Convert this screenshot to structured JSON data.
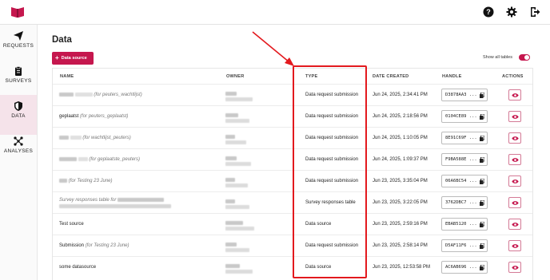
{
  "topbar": {
    "help_icon": "help-icon",
    "settings_icon": "gear-icon",
    "logout_icon": "logout-icon"
  },
  "sidebar": {
    "items": [
      {
        "label": "REQUESTS",
        "icon": "paper-plane-icon"
      },
      {
        "label": "SURVEYS",
        "icon": "clipboard-icon"
      },
      {
        "label": "DATA",
        "icon": "shield-icon",
        "active": true
      },
      {
        "label": "ANALYSES",
        "icon": "nodes-icon"
      }
    ]
  },
  "page": {
    "title": "Data",
    "add_button": "Data source",
    "show_all_label": "Show all tables"
  },
  "table": {
    "columns": [
      "NAME",
      "OWNER",
      "TYPE",
      "DATE CREATED",
      "HANDLE",
      "ACTIONS"
    ],
    "rows": [
      {
        "name": "",
        "for": "(for",
        "target": "peuters_wachtlijst)",
        "type": "Data request submission",
        "date": "Jun 24, 2025, 2:34:41 PM",
        "handle": "D3878AA3 ..."
      },
      {
        "name": "geplaatst",
        "for": "(for",
        "target": "peuters_geplaatst)",
        "type": "Data request submission",
        "date": "Jun 24, 2025, 2:18:56 PM",
        "handle": "0104CE89 ..."
      },
      {
        "name": "",
        "for": "(for",
        "target": "wachtlijst_peuters)",
        "type": "Data request submission",
        "date": "Jun 24, 2025, 1:10:05 PM",
        "handle": "8E91C69F ..."
      },
      {
        "name": "",
        "for": "(for",
        "target": "geplaatste_peuters)",
        "type": "Data request submission",
        "date": "Jun 24, 2025, 1:09:37 PM",
        "handle": "F9BA588E ..."
      },
      {
        "name": "",
        "for": "(for",
        "target": "Testing 23 June)",
        "type": "Data request submission",
        "date": "Jun 23, 2025, 3:35:04 PM",
        "handle": "06A6BC54 ..."
      },
      {
        "name": "Survey responses table for",
        "for": "",
        "target": "",
        "type": "Survey responses table",
        "date": "Jun 23, 2025, 3:22:05 PM",
        "handle": "3762DBC7 ..."
      },
      {
        "name": "Test source",
        "for": "",
        "target": "",
        "type": "Data source",
        "date": "Jun 23, 2025, 2:59:16 PM",
        "handle": "EBAB5120 ..."
      },
      {
        "name": "Submission",
        "for": "(for",
        "target": "Testing 23 June)",
        "type": "Data request submission",
        "date": "Jun 23, 2025, 2:58:14 PM",
        "handle": "D5AF11F6 ..."
      },
      {
        "name": "some datasource",
        "for": "",
        "target": "",
        "type": "Data source",
        "date": "Jun 23, 2025, 12:53:58 PM",
        "handle": "AC6AB696 ..."
      }
    ]
  },
  "annotation": {
    "highlight_color": "#e3191e",
    "accent_color": "#c5174e"
  }
}
